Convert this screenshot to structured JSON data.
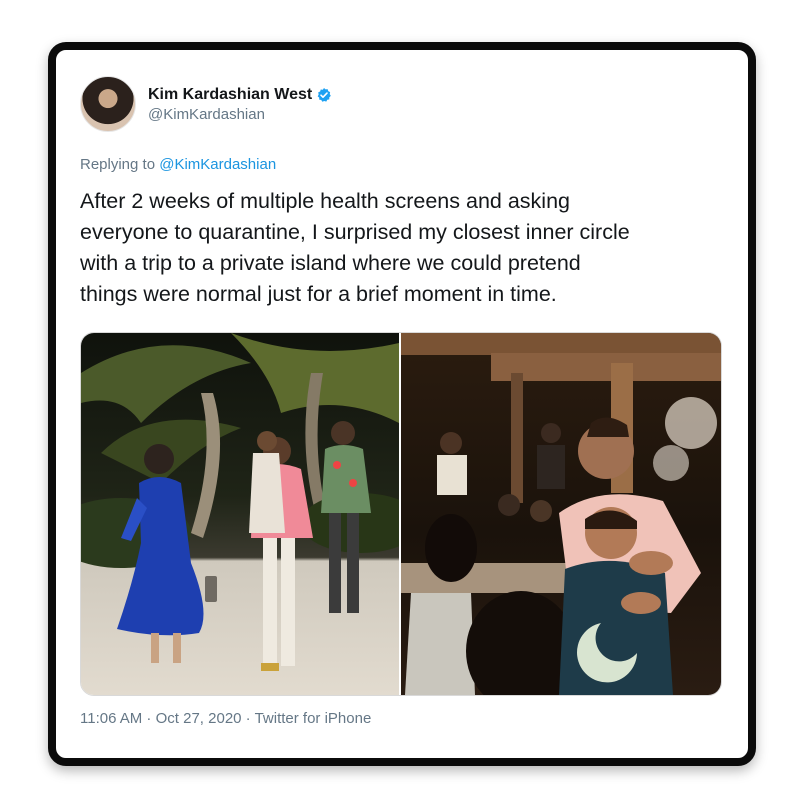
{
  "tweet": {
    "author": {
      "display_name": "Kim Kardashian West",
      "handle": "@KimKardashian",
      "verified": true
    },
    "replying_to": {
      "prefix": "Replying to",
      "mention": "@KimKardashian"
    },
    "text": "After 2 weeks of multiple health screens and asking\neveryone to quarantine, I surprised my closest inner circle\nwith a trip to a private island where we could pretend\nthings were normal just for a brief moment in time.",
    "media": [
      {
        "kind": "photo"
      },
      {
        "kind": "photo"
      }
    ],
    "meta": {
      "time": "11:06 AM",
      "date": "Oct 27, 2020",
      "source": "Twitter for iPhone",
      "separator": " · "
    }
  },
  "colors": {
    "text": "#14171a",
    "secondary": "#657786",
    "link": "#1b95e0",
    "verified": "#1da1f2"
  }
}
